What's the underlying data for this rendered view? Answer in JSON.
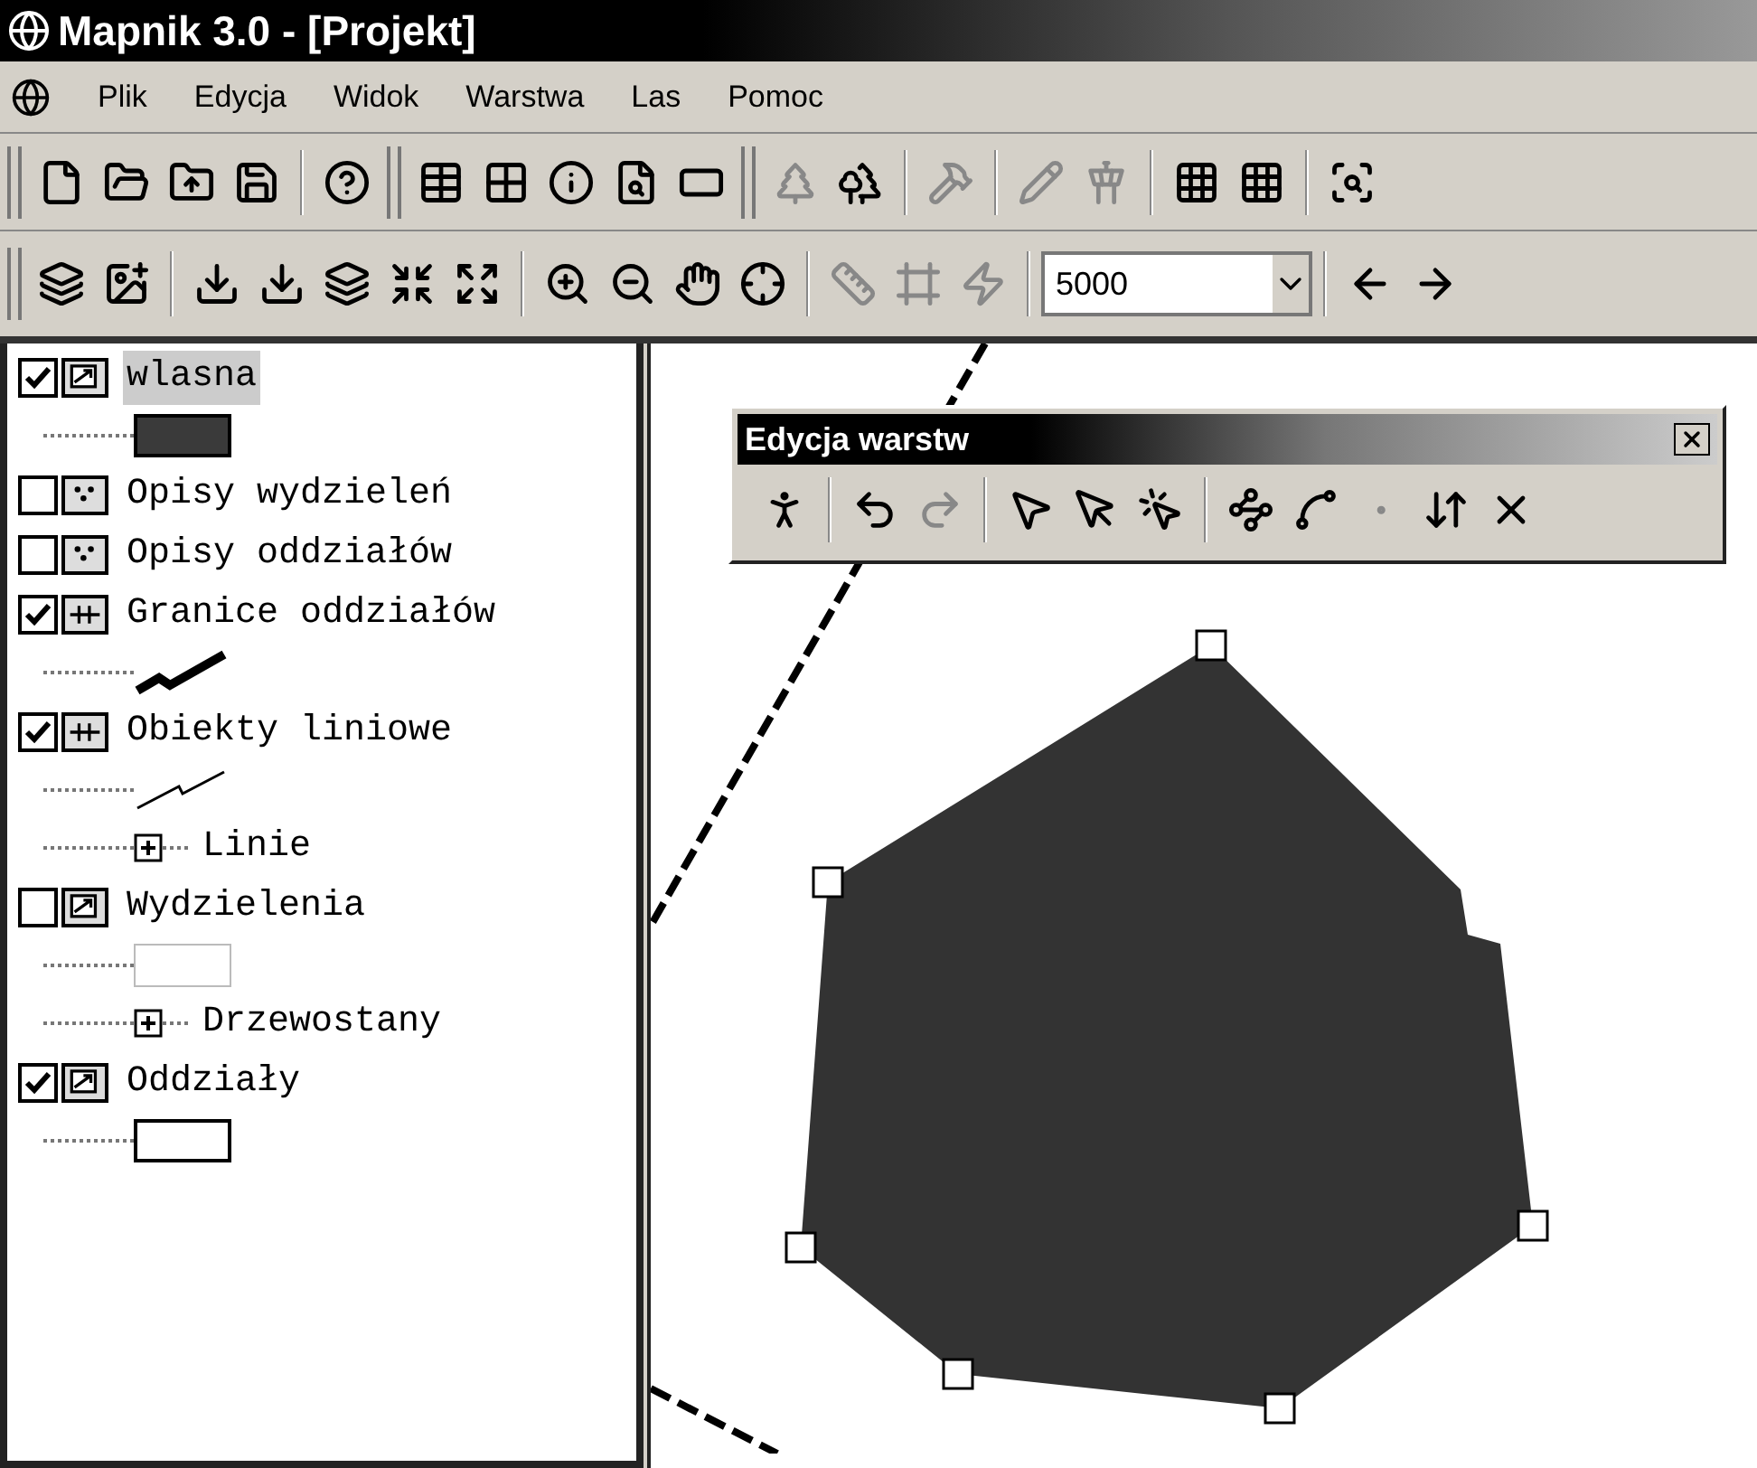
{
  "window": {
    "title": "Mapnik 3.0 - [Projekt]"
  },
  "menu": [
    {
      "label": "Plik"
    },
    {
      "label": "Edycja"
    },
    {
      "label": "Widok"
    },
    {
      "label": "Warstwa"
    },
    {
      "label": "Las"
    },
    {
      "label": "Pomoc"
    }
  ],
  "scale_combo": {
    "value": "5000"
  },
  "layers": [
    {
      "name": "wlasna",
      "checked": true,
      "selected": true,
      "kind": "polygon",
      "legend": {
        "kind": "dark-box"
      }
    },
    {
      "name": "Opisy wydzieleń",
      "checked": false,
      "selected": false,
      "kind": "labels"
    },
    {
      "name": "Opisy oddziałów",
      "checked": false,
      "selected": false,
      "kind": "labels"
    },
    {
      "name": "Granice oddziałów",
      "checked": true,
      "selected": false,
      "kind": "line",
      "legend": {
        "kind": "thick-line"
      }
    },
    {
      "name": "Obiekty liniowe",
      "checked": true,
      "selected": false,
      "kind": "line",
      "legend": {
        "kind": "thin-line"
      },
      "children": [
        {
          "name": "Linie",
          "expanded": false
        }
      ]
    },
    {
      "name": "Wydzielenia",
      "checked": false,
      "selected": false,
      "kind": "polygon",
      "legend": {
        "kind": "light-box"
      },
      "children": [
        {
          "name": "Drzewostany",
          "expanded": false
        }
      ]
    },
    {
      "name": "Oddziały",
      "checked": true,
      "selected": false,
      "kind": "polygon",
      "legend": {
        "kind": "empty-box"
      }
    }
  ],
  "edit_toolbar": {
    "title": "Edycja warstw"
  }
}
